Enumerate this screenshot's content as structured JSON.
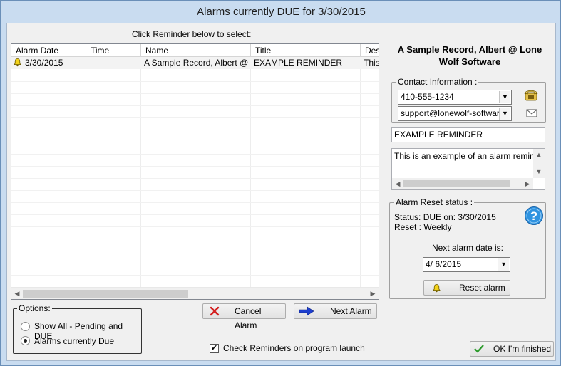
{
  "window": {
    "title": "Alarms currently DUE for 3/30/2015"
  },
  "list": {
    "hint": "Click Reminder below to select:",
    "columns": [
      "Alarm Date",
      "Time",
      "Name",
      "Title",
      "Des"
    ],
    "rows": [
      {
        "date": "3/30/2015",
        "time": "",
        "name": "A Sample Record, Albert @ ...",
        "title": "EXAMPLE REMINDER",
        "desc": "This"
      }
    ]
  },
  "options": {
    "label": "Options:",
    "show_all": "Show All - Pending and DUE",
    "alarms_due": "Alarms currently Due",
    "selected": "alarms_due"
  },
  "buttons": {
    "cancel_alarm": "Cancel Alarm",
    "next_alarm": "Next Alarm",
    "reset_alarm": "Reset alarm",
    "ok": "OK I'm finished"
  },
  "check_reminders": {
    "label": "Check Reminders on program launch",
    "checked": true
  },
  "record": {
    "title": "A Sample Record, Albert @ Lone Wolf Software",
    "contact_label": "Contact Information :",
    "phone": "410-555-1234",
    "email": "support@lonewolf-software.c",
    "reminder_title": "EXAMPLE REMINDER",
    "reminder_text": "This is an example of an alarm reminder y"
  },
  "reset": {
    "label": "Alarm Reset status :",
    "status": "Status: DUE on: 3/30/2015",
    "reset": "Reset : Weekly",
    "next_label": "Next  alarm date is:",
    "next_date": "4/  6/2015"
  },
  "colors": {
    "accent": "#1e6fd9",
    "cancel": "#d32020",
    "ok": "#2a9a2a"
  }
}
